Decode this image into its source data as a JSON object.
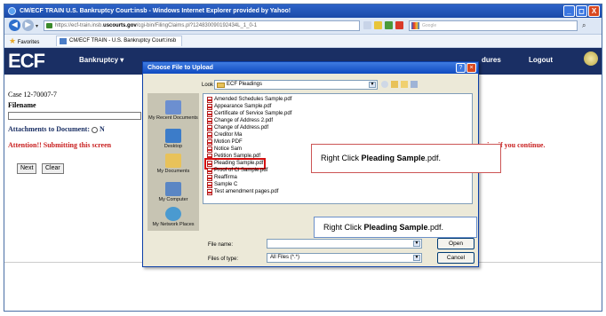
{
  "window": {
    "title": "CM/ECF TRAIN   U.S. Bankruptcy Court:insb - Windows Internet Explorer provided by Yahoo!",
    "buttons": [
      "_",
      "◻",
      "X"
    ]
  },
  "address": {
    "url_prefix": "https://ecf-train.insb.",
    "url_domain": "uscourts.gov",
    "url_rest": "/cgi-bin/FilingClaims.pl?124830090192434L_1_0-1",
    "search_placeholder": "Google"
  },
  "favorites": {
    "label": "Favorites",
    "tab_label": "CM/ECF TRAIN - U.S. Bankruptcy Court:insb"
  },
  "ecf_header": {
    "logo": "ECF",
    "menu_bankruptcy": "Bankruptcy ▾",
    "menu_procedures": "dures",
    "menu_logout": "Logout"
  },
  "page": {
    "case": "Case 12-70007-7",
    "filename_label": "Filename",
    "attachments_label": "Attachments to Document:",
    "attachments_value": "N",
    "attention": "Attention!! Submitting this screen",
    "attention_right": "sion if you continue.",
    "next_button": "Next",
    "clear_button": "Clear"
  },
  "dialog": {
    "title": "Choose File to Upload",
    "look_in_label": "Look in:",
    "look_in_value": "ECF Pleadings",
    "places": [
      {
        "label": "My Recent Documents",
        "icon": "recent-docs-icon"
      },
      {
        "label": "Desktop",
        "icon": "desktop-icon"
      },
      {
        "label": "My Documents",
        "icon": "my-documents-icon"
      },
      {
        "label": "My Computer",
        "icon": "my-computer-icon"
      },
      {
        "label": "My Network Places",
        "icon": "network-places-icon"
      }
    ],
    "files": [
      "Amended Schedules Sample.pdf",
      "Appearance Sample.pdf",
      "Certificate of Service Sample.pdf",
      "Change of Address 2.pdf",
      "Change of Address.pdf",
      "Creditor Ma",
      "Motion PDF",
      "Notice Sam",
      "Petition Sample.pdf",
      "Pleading Sample.pdf",
      "Proof of Cl    Sample.pdf",
      "Reaffirma",
      "Sample C",
      "Test amendment pages.pdf"
    ],
    "selected_index": 9,
    "file_name_label": "File name:",
    "file_name_value": "",
    "files_of_type_label": "Files of type:",
    "files_of_type_value": "All Files (*.*)",
    "open_button": "Open",
    "cancel_button": "Cancel"
  },
  "callouts": {
    "c1_prefix": "Right Click ",
    "c1_bold": "Pleading Sample",
    "c1_suffix": ".pdf.",
    "c2_prefix": "Right Click ",
    "c2_bold": "Pleading Sample",
    "c2_suffix": ".pdf."
  }
}
